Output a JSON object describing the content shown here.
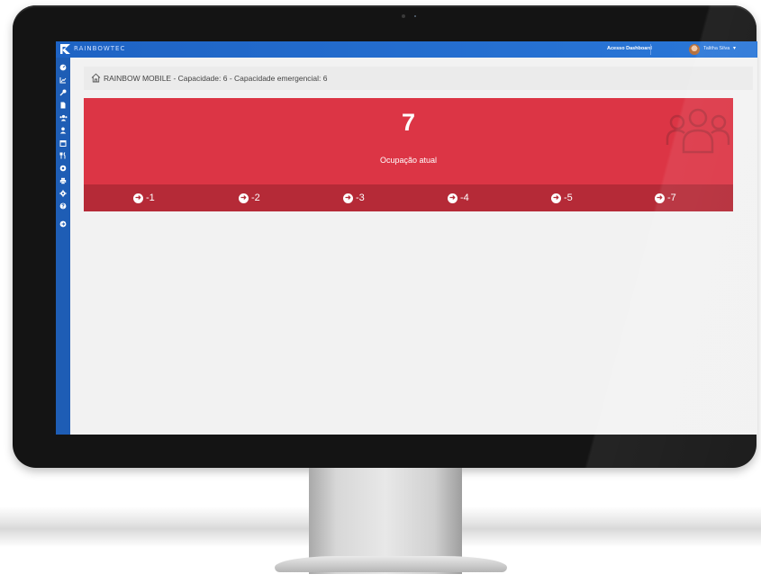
{
  "app": {
    "brand": "RAINBOWTEC",
    "nav_link": "Acesso Dashboard",
    "user_name": "Talitha Silva",
    "user_caret": "▾"
  },
  "sidebar": {
    "items": [
      {
        "icon": "dashboard-icon"
      },
      {
        "icon": "chart-icon"
      },
      {
        "icon": "key-icon"
      },
      {
        "icon": "file-icon"
      },
      {
        "icon": "users-icon"
      },
      {
        "icon": "user-icon"
      },
      {
        "icon": "calendar-icon"
      },
      {
        "icon": "utensils-icon"
      },
      {
        "icon": "clock-icon"
      },
      {
        "icon": "print-icon"
      },
      {
        "icon": "gear-icon"
      },
      {
        "icon": "help-icon"
      },
      {
        "icon": "arrow-right-icon"
      }
    ]
  },
  "breadcrumb": {
    "text": "RAINBOW MOBILE - Capacidade: 6 - Capacidade emergencial: 6"
  },
  "card": {
    "value": "7",
    "label": "Ocupação atual",
    "color": "#dc3545",
    "footer_color": "#b52a37",
    "actions": [
      {
        "label": "-1"
      },
      {
        "label": "-2"
      },
      {
        "label": "-3"
      },
      {
        "label": "-4"
      },
      {
        "label": "-5"
      },
      {
        "label": "-7"
      }
    ]
  }
}
